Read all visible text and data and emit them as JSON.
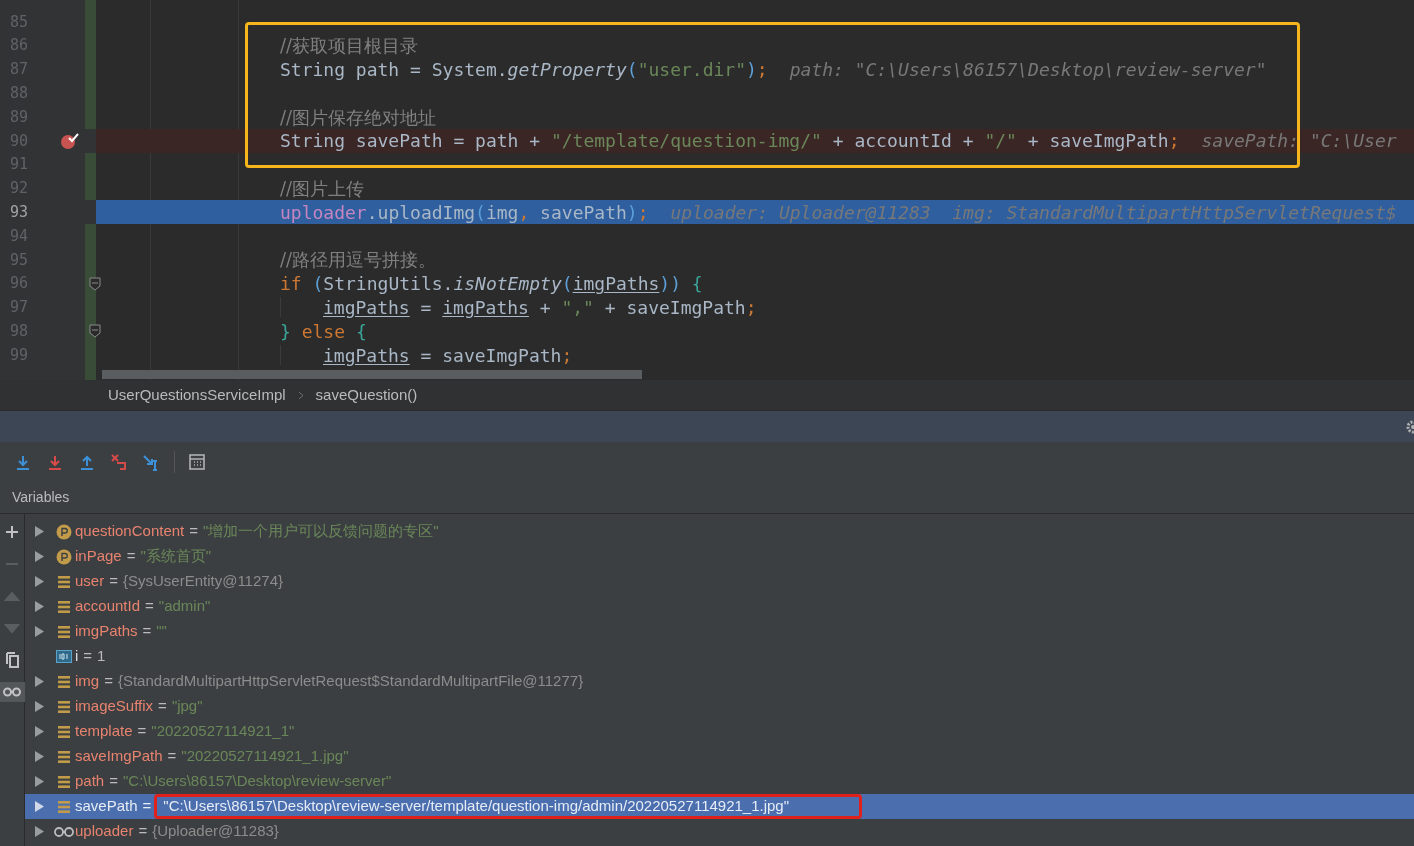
{
  "editor": {
    "lines": [
      {
        "number": "85",
        "breakpoint": false,
        "current": false,
        "fold": false
      },
      {
        "number": "86",
        "breakpoint": false,
        "current": false,
        "fold": false,
        "tokens": [
          {
            "kind": "comment",
            "text": "//获取项目根目录"
          }
        ]
      },
      {
        "number": "87",
        "breakpoint": false,
        "current": false,
        "fold": false,
        "tokens": [
          {
            "kind": "plain",
            "text": "String path = System."
          },
          {
            "kind": "method",
            "text": "getProperty"
          },
          {
            "kind": "paren",
            "text": "("
          },
          {
            "kind": "string",
            "text": "\"user.dir\""
          },
          {
            "kind": "paren",
            "text": ")"
          },
          {
            "kind": "punct",
            "text": ";"
          },
          {
            "kind": "hint",
            "text": "path: \"C:\\Users\\86157\\Desktop\\review-server\""
          }
        ]
      },
      {
        "number": "88",
        "breakpoint": false,
        "current": false,
        "fold": false
      },
      {
        "number": "89",
        "breakpoint": false,
        "current": false,
        "fold": false,
        "tokens": [
          {
            "kind": "comment",
            "text": "//图片保存绝对地址"
          }
        ]
      },
      {
        "number": "90",
        "breakpoint": true,
        "current": false,
        "fold": false,
        "tokens": [
          {
            "kind": "plain",
            "text": "String savePath = path + "
          },
          {
            "kind": "string",
            "text": "\"/template/question-img/\""
          },
          {
            "kind": "plain",
            "text": " + accountId + "
          },
          {
            "kind": "string",
            "text": "\"/\""
          },
          {
            "kind": "plain",
            "text": " + saveImgPath"
          },
          {
            "kind": "punct",
            "text": ";"
          },
          {
            "kind": "hint",
            "text": "savePath: \"C:\\User"
          }
        ]
      },
      {
        "number": "91",
        "breakpoint": false,
        "current": false,
        "fold": false
      },
      {
        "number": "92",
        "breakpoint": false,
        "current": false,
        "fold": false,
        "tokens": [
          {
            "kind": "comment",
            "text": "//图片上传"
          }
        ]
      },
      {
        "number": "93",
        "breakpoint": false,
        "current": true,
        "fold": false,
        "tokens": [
          {
            "kind": "field",
            "text": "uploader"
          },
          {
            "kind": "plain",
            "text": ".uploadImg"
          },
          {
            "kind": "paren",
            "text": "("
          },
          {
            "kind": "plain",
            "text": "img"
          },
          {
            "kind": "punct",
            "text": ","
          },
          {
            "kind": "plain",
            "text": " savePath"
          },
          {
            "kind": "paren",
            "text": ")"
          },
          {
            "kind": "punct",
            "text": ";"
          },
          {
            "kind": "hint",
            "text": "uploader: Uploader@11283  img: StandardMultipartHttpServletRequest$"
          }
        ]
      },
      {
        "number": "94",
        "breakpoint": false,
        "current": false,
        "fold": false
      },
      {
        "number": "95",
        "breakpoint": false,
        "current": false,
        "fold": false,
        "tokens": [
          {
            "kind": "comment",
            "text": "//路径用逗号拼接。"
          }
        ]
      },
      {
        "number": "96",
        "breakpoint": false,
        "current": false,
        "fold": true,
        "tokens": [
          {
            "kind": "keyword",
            "text": "if "
          },
          {
            "kind": "paren",
            "text": "("
          },
          {
            "kind": "plain",
            "text": "StringUtils."
          },
          {
            "kind": "method",
            "text": "isNotEmpty"
          },
          {
            "kind": "paren",
            "text": "("
          },
          {
            "kind": "var",
            "text": "imgPaths"
          },
          {
            "kind": "paren",
            "text": "))"
          },
          {
            "kind": "brace",
            "text": " {"
          }
        ]
      },
      {
        "number": "97",
        "breakpoint": false,
        "current": false,
        "fold": false,
        "indented": true,
        "tokens": [
          {
            "kind": "var",
            "text": "imgPaths"
          },
          {
            "kind": "plain",
            "text": " = "
          },
          {
            "kind": "var",
            "text": "imgPaths"
          },
          {
            "kind": "plain",
            "text": " + "
          },
          {
            "kind": "string",
            "text": "\",\""
          },
          {
            "kind": "plain",
            "text": " + saveImgPath"
          },
          {
            "kind": "punct",
            "text": ";"
          }
        ]
      },
      {
        "number": "98",
        "breakpoint": false,
        "current": false,
        "fold": true,
        "tokens": [
          {
            "kind": "brace",
            "text": "}"
          },
          {
            "kind": "keyword",
            "text": " else "
          },
          {
            "kind": "brace",
            "text": "{"
          }
        ]
      },
      {
        "number": "99",
        "breakpoint": false,
        "current": false,
        "fold": false,
        "indented": true,
        "tokens": [
          {
            "kind": "var",
            "text": "imgPaths"
          },
          {
            "kind": "plain",
            "text": " = saveImgPath"
          },
          {
            "kind": "punct",
            "text": ";"
          }
        ]
      }
    ]
  },
  "breadcrumb": [
    "UserQuestionsServiceImpl",
    "saveQuestion()"
  ],
  "debugger": {
    "tab": "Variables",
    "side_tools": [
      {
        "kind": "add",
        "disabled": false,
        "selected": false
      },
      {
        "kind": "remove",
        "disabled": true,
        "selected": false
      },
      {
        "kind": "up",
        "disabled": true,
        "selected": false
      },
      {
        "kind": "down",
        "disabled": true,
        "selected": false
      },
      {
        "kind": "copy",
        "disabled": false,
        "selected": false
      },
      {
        "kind": "watches",
        "disabled": false,
        "selected": true
      }
    ],
    "variables": [
      {
        "kind": "param",
        "name": "questionContent",
        "op": "=",
        "value": {
          "kind": "string",
          "text": "\"增加一个用户可以反馈问题的专区\""
        },
        "expandable": true,
        "selected": false,
        "circled": false
      },
      {
        "kind": "param",
        "name": "inPage",
        "op": "=",
        "value": {
          "kind": "string",
          "text": "\"系统首页\""
        },
        "expandable": true,
        "selected": false,
        "circled": false
      },
      {
        "kind": "field",
        "name": "user",
        "op": "=",
        "value": {
          "kind": "object",
          "text": "{SysUserEntity@11274}"
        },
        "expandable": true,
        "selected": false,
        "circled": false
      },
      {
        "kind": "field",
        "name": "accountId",
        "op": "=",
        "value": {
          "kind": "string",
          "text": "\"admin\""
        },
        "expandable": true,
        "selected": false,
        "circled": false
      },
      {
        "kind": "field",
        "name": "imgPaths",
        "op": "=",
        "value": {
          "kind": "string",
          "text": "\"\""
        },
        "expandable": true,
        "selected": false,
        "circled": false
      },
      {
        "kind": "int",
        "name": "i",
        "op": "=",
        "value": {
          "kind": "number",
          "text": "1"
        },
        "expandable": false,
        "selected": false,
        "circled": false
      },
      {
        "kind": "field",
        "name": "img",
        "op": "=",
        "value": {
          "kind": "object",
          "text": "{StandardMultipartHttpServletRequest$StandardMultipartFile@11277}"
        },
        "expandable": true,
        "selected": false,
        "circled": false
      },
      {
        "kind": "field",
        "name": "imageSuffix",
        "op": "=",
        "value": {
          "kind": "string",
          "text": "\"jpg\""
        },
        "expandable": true,
        "selected": false,
        "circled": false
      },
      {
        "kind": "field",
        "name": "template",
        "op": "=",
        "value": {
          "kind": "string",
          "text": "\"20220527114921_1\""
        },
        "expandable": true,
        "selected": false,
        "circled": false
      },
      {
        "kind": "field",
        "name": "saveImgPath",
        "op": "=",
        "value": {
          "kind": "string",
          "text": "\"20220527114921_1.jpg\""
        },
        "expandable": true,
        "selected": false,
        "circled": false
      },
      {
        "kind": "field",
        "name": "path",
        "op": "=",
        "value": {
          "kind": "string",
          "text": "\"C:\\Users\\86157\\Desktop\\review-server\""
        },
        "expandable": true,
        "selected": false,
        "circled": false
      },
      {
        "kind": "field",
        "name": "savePath",
        "op": "=",
        "value": {
          "kind": "string",
          "text": "\"C:\\Users\\86157\\Desktop\\review-server/template/question-img/admin/20220527114921_1.jpg\""
        },
        "expandable": true,
        "selected": true,
        "circled": true
      },
      {
        "kind": "watch",
        "name": "uploader",
        "op": "=",
        "value": {
          "kind": "object",
          "text": "{Uploader@11283}"
        },
        "expandable": true,
        "selected": false,
        "circled": false
      }
    ]
  }
}
